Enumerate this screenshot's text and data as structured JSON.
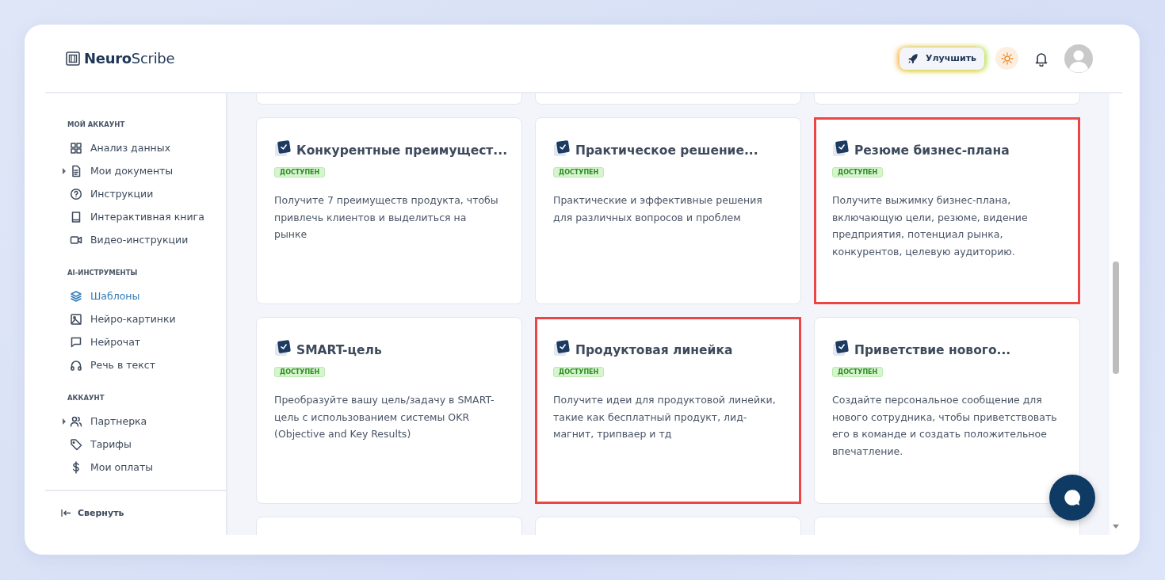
{
  "logo": {
    "text_bold": "Neuro",
    "text_rest": "Scribe"
  },
  "header": {
    "upgrade_button": "Улучшить"
  },
  "sidebar": {
    "sections": [
      {
        "title": "МОЙ АККАУНТ",
        "items": [
          {
            "label": "Анализ данных",
            "selected": false,
            "expandable": false
          },
          {
            "label": "Мои документы",
            "selected": false,
            "expandable": true
          },
          {
            "label": "Инструкции",
            "selected": false,
            "expandable": false
          },
          {
            "label": "Интерактивная книга",
            "selected": false,
            "expandable": false
          },
          {
            "label": "Видео-инструкции",
            "selected": false,
            "expandable": false
          }
        ]
      },
      {
        "title": "AI-ИНСТРУМЕНТЫ",
        "items": [
          {
            "label": "Шаблоны",
            "selected": true,
            "expandable": false
          },
          {
            "label": "Нейро-картинки",
            "selected": false,
            "expandable": false
          },
          {
            "label": "Нейрочат",
            "selected": false,
            "expandable": false
          },
          {
            "label": "Речь в текст",
            "selected": false,
            "expandable": false
          }
        ]
      },
      {
        "title": "АККАУНТ",
        "items": [
          {
            "label": "Партнерка",
            "selected": false,
            "expandable": true
          },
          {
            "label": "Тарифы",
            "selected": false,
            "expandable": false
          },
          {
            "label": "Мои оплаты",
            "selected": false,
            "expandable": false
          }
        ]
      }
    ],
    "collapse": "Свернуть"
  },
  "cards": [
    {
      "title": "Конкурентные преимущест...",
      "badge": "ДОСТУПЕН",
      "description": "Получите 7 преимуществ продукта, чтобы привлечь клиентов и выделиться на рынке",
      "highlighted": false
    },
    {
      "title": "Практическое решение...",
      "badge": "ДОСТУПЕН",
      "description": "Практические и эффективные решения для различных вопросов и проблем",
      "highlighted": false
    },
    {
      "title": "Резюме бизнес-плана",
      "badge": "ДОСТУПЕН",
      "description": "Получите выжимку бизнес-плана, включающую цели, резюме, видение предприятия, потенциал рынка, конкурентов, целевую аудиторию.",
      "highlighted": true
    },
    {
      "title": "SMART-цель",
      "badge": "ДОСТУПЕН",
      "description": "Преобразуйте вашу цель/задачу в SMART-цель с использованием системы OKR (Objective and Key Results)",
      "highlighted": false
    },
    {
      "title": "Продуктовая линейка",
      "badge": "ДОСТУПЕН",
      "description": "Получите идеи для продуктовой линейки, такие как бесплатный продукт, лид-магнит, трипваер и тд",
      "highlighted": true
    },
    {
      "title": "Приветствие нового...",
      "badge": "ДОСТУПЕН",
      "description": "Создайте персональное сообщение для нового сотрудника, чтобы приветствовать его в команде и создать положительное впечатление.",
      "highlighted": false
    }
  ]
}
